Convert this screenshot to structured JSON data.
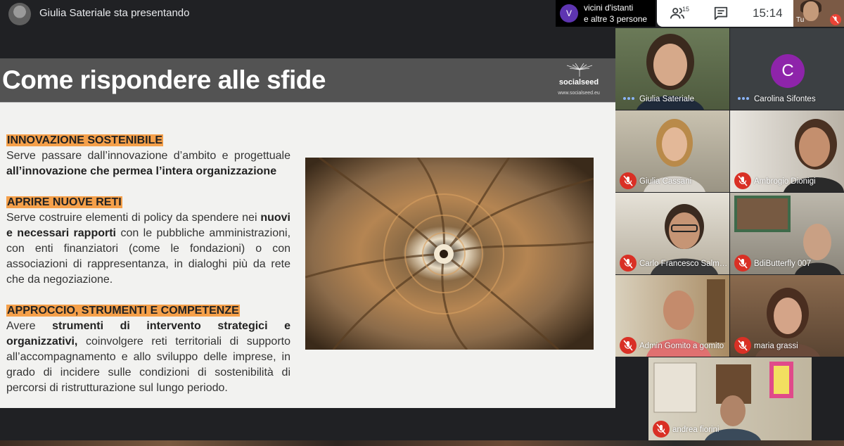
{
  "presenter": {
    "title": "Giulia Sateriale sta presentando"
  },
  "join_notification": {
    "avatar_letter": "V",
    "line1": "vicini d'istanti",
    "line2": "e altre 3 persone"
  },
  "controls": {
    "people_icon": "people-icon",
    "people_count": "15",
    "chat_icon": "chat-icon",
    "time": "15:14"
  },
  "self_view": {
    "label": "Tu"
  },
  "slide": {
    "title": "Come rispondere alle sfide",
    "brand_name": "socialseed",
    "brand_url": "www.socialseed.eu",
    "sections": [
      {
        "heading": "INNOVAZIONE SOSTENIBILE",
        "text_plain": "Serve passare dall’innovazione d’ambito e progettuale",
        "text_bold": "all’innovazione che permea l’intera organizzazione"
      },
      {
        "heading": "APRIRE NUOVE RETI",
        "text_a": "Serve costruire elementi di policy da spendere nei",
        "text_bold": "nuovi e necessari rapporti",
        "text_b": "con le pubbliche amministrazioni, con enti finanziatori (come le fondazioni) o con associazioni di rappresentanza, in dialoghi più da rete che da negoziazione."
      },
      {
        "heading": "APPROCCIO, STRUMENTI E COMPETENZE",
        "text_a": "Avere",
        "text_bold": "strumenti di intervento strategici e organizzativi,",
        "text_b": "coinvolgere reti territoriali di supporto all’accompagnamento e allo sviluppo delle imprese, in grado di incidere sulle condizioni di sostenibilità di percorsi di ristrutturazione sul lungo periodo."
      }
    ]
  },
  "participants": [
    {
      "name": "Giulia Sateriale",
      "status": "speaking"
    },
    {
      "name": "Carolina Sifontes",
      "status": "speaking",
      "avatar_letter": "C",
      "avatar_color": "#8e24aa"
    },
    {
      "name": "Giulia Cassani",
      "status": "muted"
    },
    {
      "name": "Ambrogio Dionigi",
      "status": "muted"
    },
    {
      "name": "Carlo Francesco Salm…",
      "status": "muted"
    },
    {
      "name": "BdiButterfly 007",
      "status": "muted"
    },
    {
      "name": "Admin Gomito a gomito",
      "status": "muted"
    },
    {
      "name": "maria grassi",
      "status": "muted"
    },
    {
      "name": "andrea fiorini",
      "status": "muted"
    }
  ]
}
